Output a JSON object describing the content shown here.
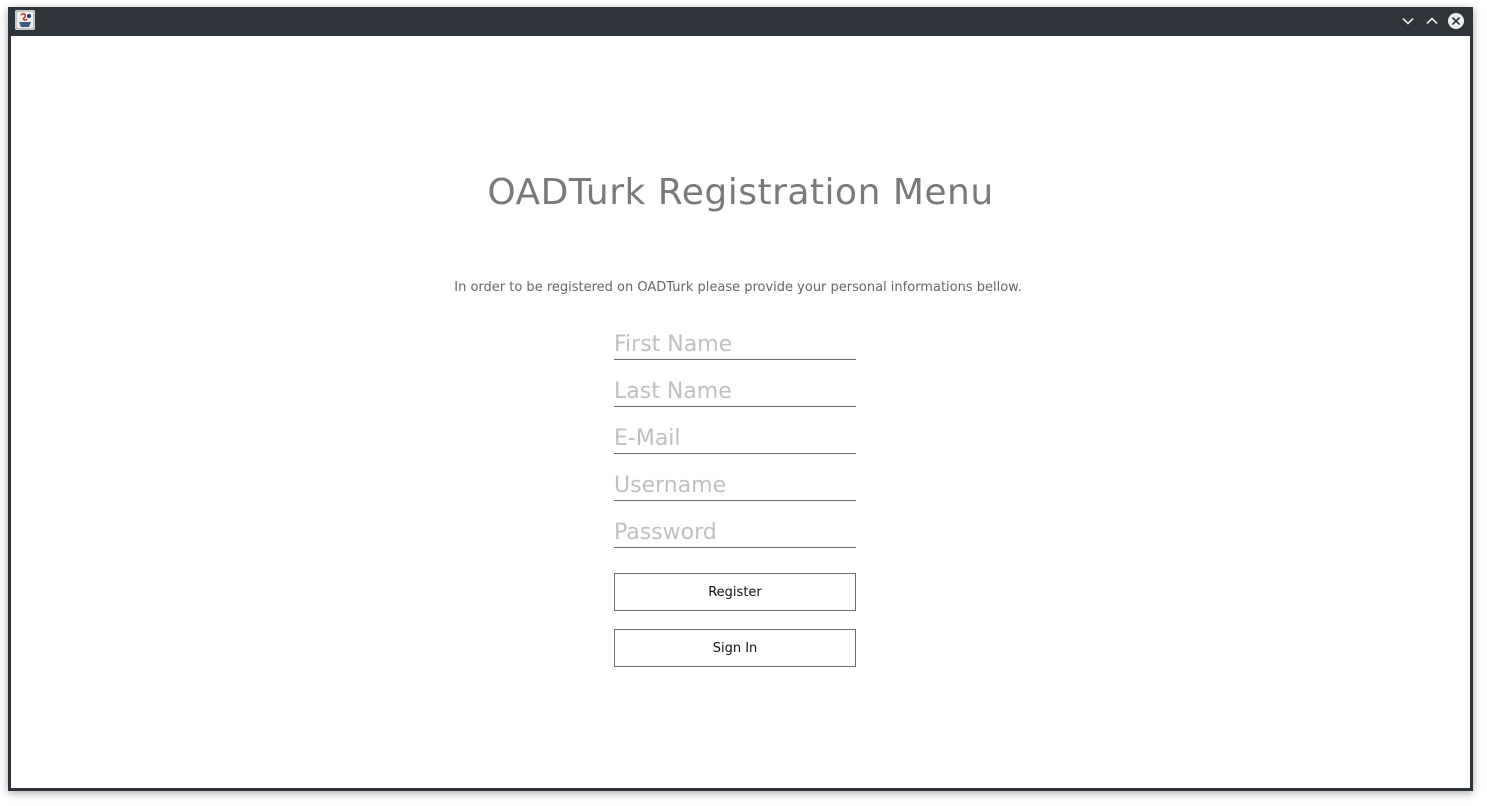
{
  "window": {
    "controls": {
      "minimize_icon": "chevron-down-icon",
      "maximize_icon": "chevron-up-icon",
      "close_icon": "close-circle-icon"
    }
  },
  "form": {
    "title": "OADTurk Registration Menu",
    "subtitle": "In order to be registered on OADTurk please provide your personal informations bellow.",
    "fields": {
      "first_name": {
        "placeholder": "First Name",
        "value": ""
      },
      "last_name": {
        "placeholder": "Last Name",
        "value": ""
      },
      "email": {
        "placeholder": "E-Mail",
        "value": ""
      },
      "username": {
        "placeholder": "Username",
        "value": ""
      },
      "password": {
        "placeholder": "Password",
        "value": ""
      }
    },
    "buttons": {
      "register": "Register",
      "sign_in": "Sign In"
    }
  },
  "colors": {
    "titlebar": "#2f343a",
    "title_text": "#7a7a7a",
    "placeholder_text": "#c0c0c0"
  }
}
